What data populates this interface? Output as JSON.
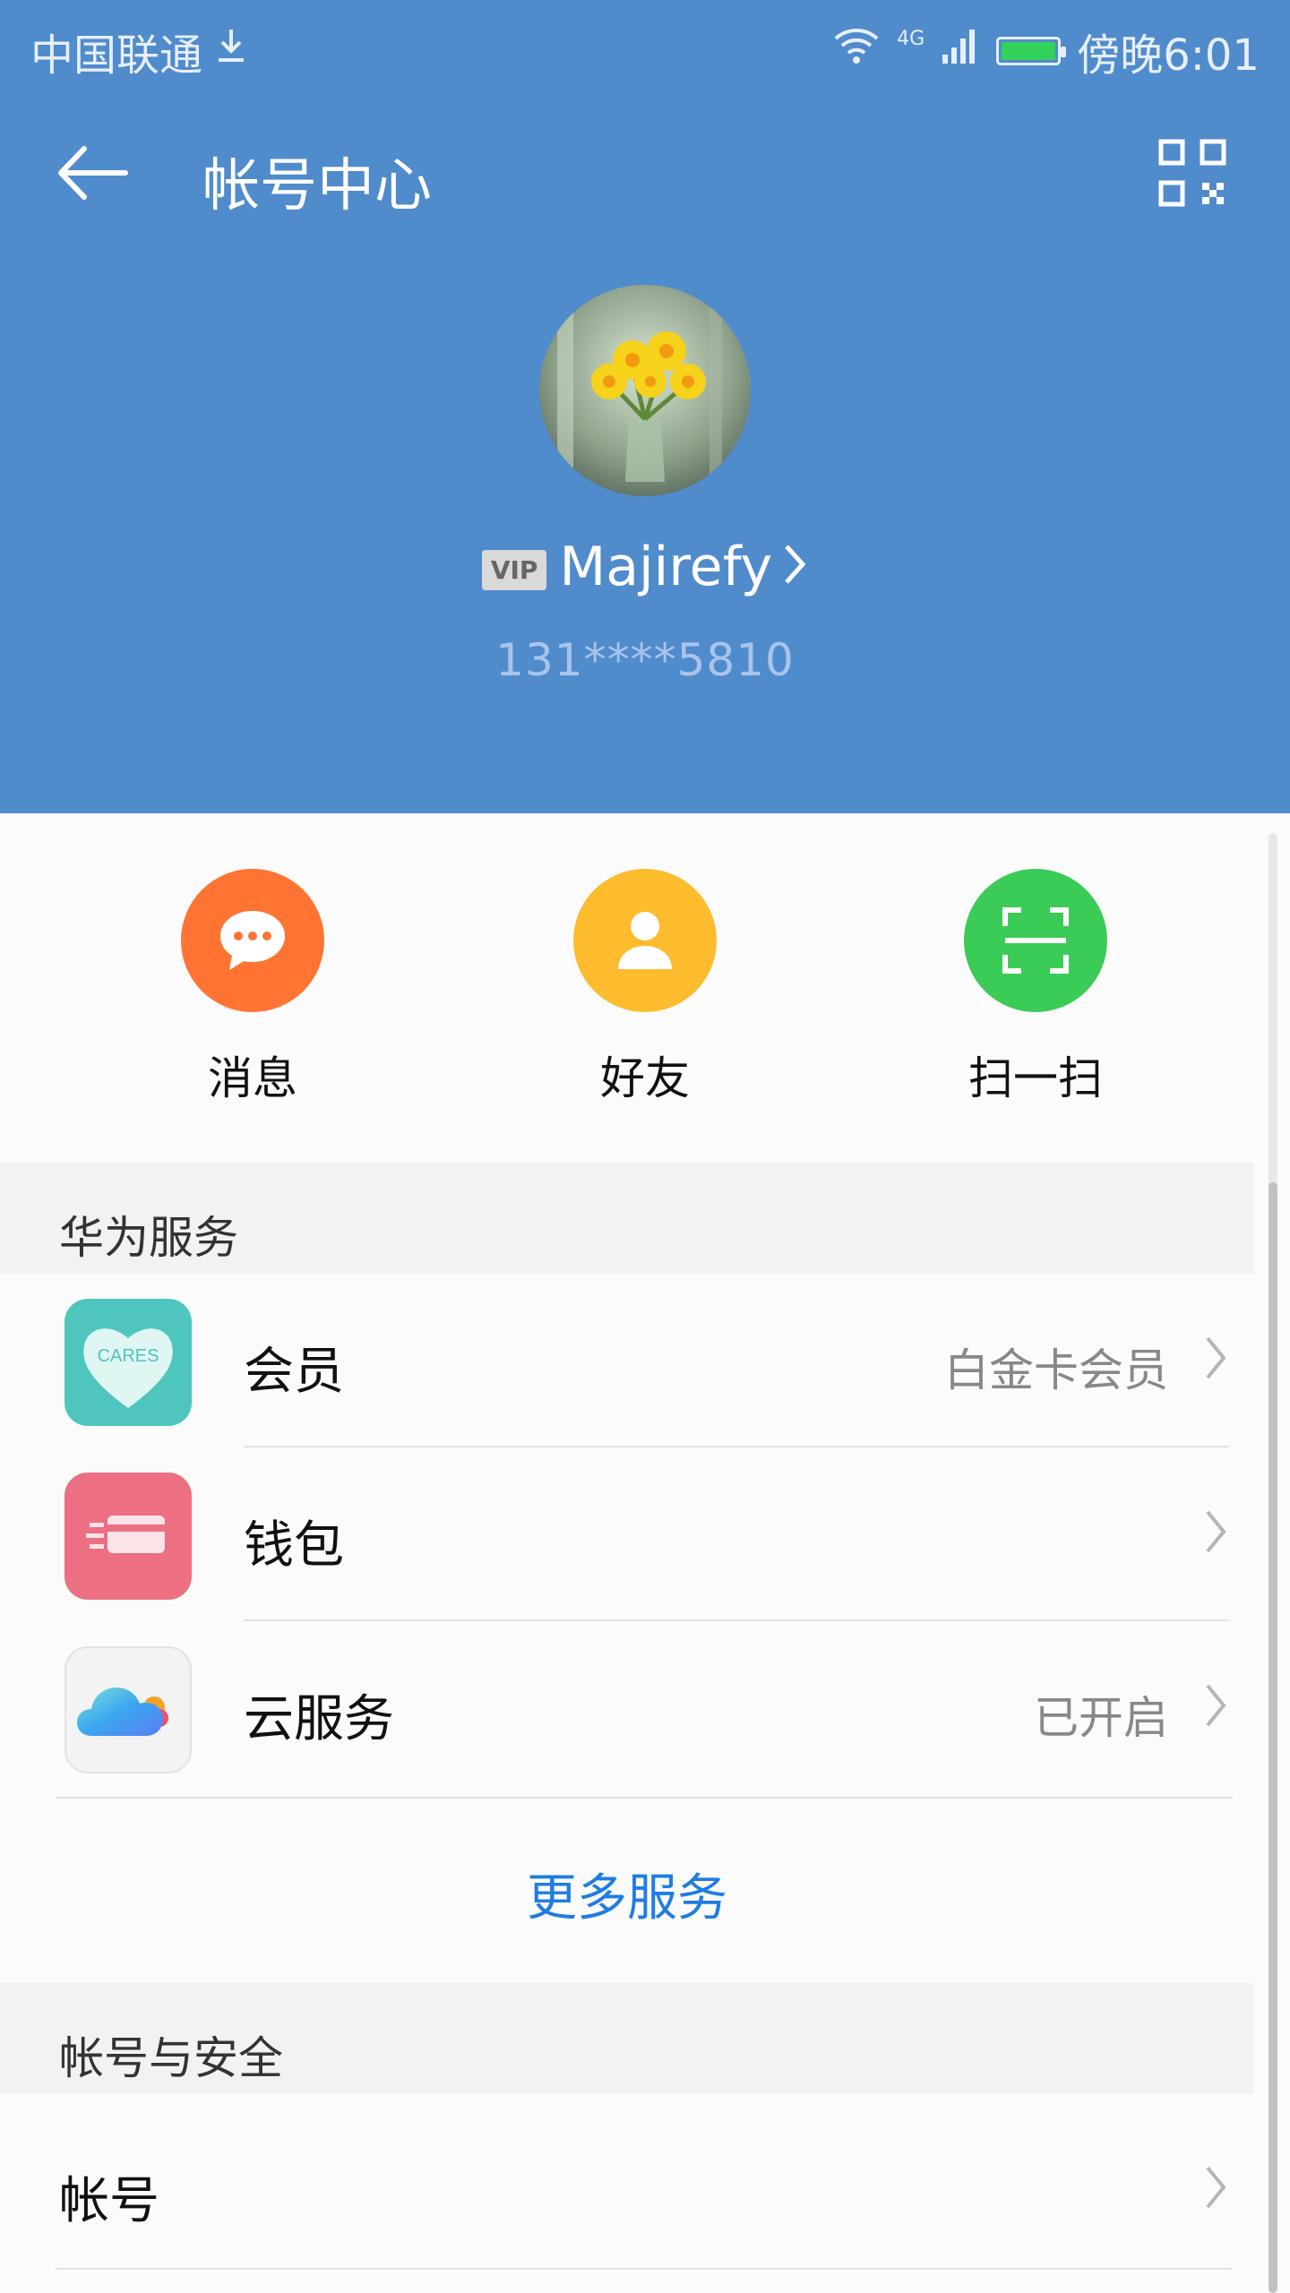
{
  "status_bar": {
    "carrier": "中国联通",
    "network": "4G",
    "time": "傍晚6:01"
  },
  "app_bar": {
    "title": "帐号中心"
  },
  "profile": {
    "vip_label": "VIP",
    "username": "Majirefy",
    "phone": "131****5810"
  },
  "actions": [
    {
      "label": "消息",
      "color": "#ff7433"
    },
    {
      "label": "好友",
      "color": "#fcbc2d"
    },
    {
      "label": "扫一扫",
      "color": "#3bcb57"
    }
  ],
  "huawei_services": {
    "header": "华为服务",
    "items": [
      {
        "title": "会员",
        "value": "白金卡会员",
        "icon_text": "CARES"
      },
      {
        "title": "钱包",
        "value": ""
      },
      {
        "title": "云服务",
        "value": "已开启"
      }
    ],
    "more_label": "更多服务"
  },
  "account_security": {
    "header": "帐号与安全",
    "items": [
      {
        "title": "帐号"
      }
    ]
  },
  "colors": {
    "header_bg": "#508bcc",
    "link": "#1f7de0"
  }
}
